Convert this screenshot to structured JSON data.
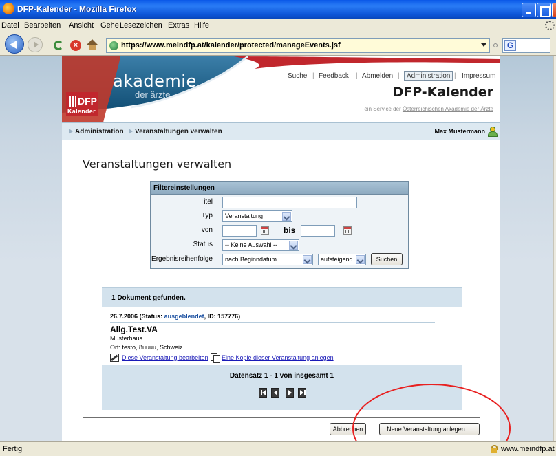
{
  "window": {
    "title": "DFP-Kalender - Mozilla Firefox"
  },
  "menubar": [
    "Datei",
    "Bearbeiten",
    "Ansicht",
    "Gehe",
    "Lesezeichen",
    "Extras",
    "Hilfe"
  ],
  "navbar": {
    "url": "https://www.meindfp.at/kalender/protected/manageEvents.jsf",
    "search_engine_letter": "G"
  },
  "header": {
    "logo_main": "akademie",
    "logo_sub": "der ärzte",
    "badge_top": "DFP",
    "badge_bottom": "Kalender",
    "nav": [
      "Suche",
      "Feedback",
      "Abmelden",
      "Administration",
      "Impressum"
    ],
    "nav_separator": "|",
    "brand": "DFP-Kalender",
    "tagline_prefix": "ein Service der",
    "tagline_link": "Österreichischen Akademie der Ärzte",
    "colors": {
      "accent_red": "#c1272d",
      "logo_blue": "#1d5f86"
    }
  },
  "breadcrumb": {
    "items": [
      "Administration",
      "Veranstaltungen verwalten"
    ],
    "user": "Max Mustermann"
  },
  "page_title": "Veranstaltungen verwalten",
  "filter": {
    "heading": "Filtereinstellungen",
    "labels": {
      "titel": "Titel",
      "typ": "Typ",
      "von": "von",
      "bis": "bis",
      "status": "Status",
      "order": "Ergebnisreihenfolge"
    },
    "titel_value": "",
    "typ_value": "Veranstaltung",
    "von_value": "",
    "bis_value": "",
    "status_value": "-- Keine Auswahl --",
    "order_value": "nach Beginndatum",
    "direction_value": "aufsteigend",
    "search_button": "Suchen"
  },
  "results": {
    "summary": "1 Dokument gefunden.",
    "item": {
      "date": "26.7.2006",
      "status_prefix": "(Status:",
      "status": "ausgeblendet",
      "id_text": ", ID: 157776)",
      "title": "Allg.Test.VA",
      "subtitle": "Musterhaus",
      "ort": "Ort: testo, 8uuuu, Schweiz",
      "edit_link": "Diese Veranstaltung bearbeiten",
      "copy_link": "Eine Kopie dieser Veranstaltung anlegen"
    },
    "pager_text": "Datensatz 1 - 1 von insgesamt 1"
  },
  "actions": {
    "cancel": "Abbrechen",
    "new_event": "Neue Veranstaltung anlegen ..."
  },
  "statusbar": {
    "status": "Fertig",
    "domain": "www.meindfp.at"
  }
}
